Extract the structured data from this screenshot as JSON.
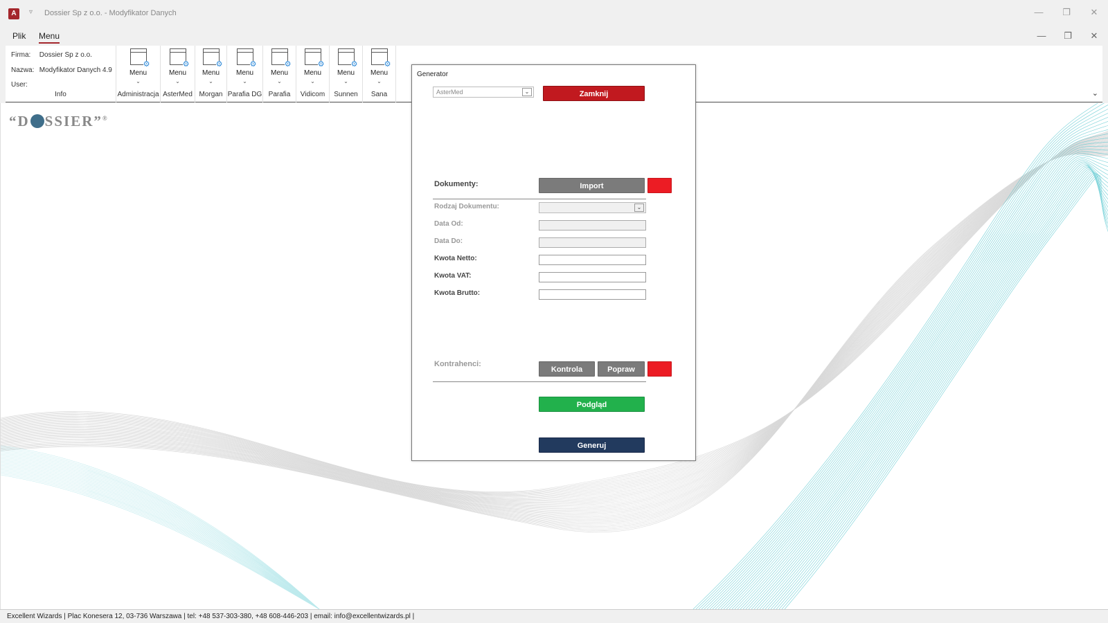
{
  "window": {
    "title": "Dossier Sp z o.o. - Modyfikator Danych",
    "app_icon": "A"
  },
  "ribbon": {
    "tabs": [
      {
        "label": "Plik",
        "active": false
      },
      {
        "label": "Menu",
        "active": true
      }
    ],
    "info": {
      "firma_label": "Firma:",
      "firma_value": "Dossier Sp z o.o.",
      "nazwa_label": "Nazwa:",
      "nazwa_value": "Modyfikator Danych 4.9",
      "user_label": "User:",
      "user_value": "",
      "caption": "Info"
    },
    "groups": [
      {
        "button": "Menu",
        "caption": "Administracja"
      },
      {
        "button": "Menu",
        "caption": "AsterMed"
      },
      {
        "button": "Menu",
        "caption": "Morgan"
      },
      {
        "button": "Menu",
        "caption": "Parafia DG"
      },
      {
        "button": "Menu",
        "caption": "Parafia"
      },
      {
        "button": "Menu",
        "caption": "Vidicom"
      },
      {
        "button": "Menu",
        "caption": "Sunnen"
      },
      {
        "button": "Menu",
        "caption": "Sana"
      }
    ]
  },
  "logo": {
    "left": "“D",
    "right": "SSIER”",
    "mark": "®"
  },
  "dialog": {
    "title": "Generator",
    "company_select": "AsterMed",
    "close_button": "Zamknij",
    "dokumenty_label": "Dokumenty:",
    "import_button": "Import",
    "fields": [
      {
        "label": "Rodzaj Dokumentu:",
        "type": "select",
        "disabled": true
      },
      {
        "label": "Data Od:",
        "type": "text",
        "disabled": true
      },
      {
        "label": "Data Do:",
        "type": "text",
        "disabled": true
      },
      {
        "label": "Kwota Netto:",
        "type": "text",
        "disabled": false
      },
      {
        "label": "Kwota VAT:",
        "type": "text",
        "disabled": false
      },
      {
        "label": "Kwota Brutto:",
        "type": "text",
        "disabled": false
      }
    ],
    "kontrahenci_label": "Kontrahenci:",
    "kontrola_button": "Kontrola",
    "popraw_button": "Popraw",
    "preview_button": "Podgląd",
    "generate_button": "Generuj"
  },
  "status_bar": {
    "text": "Excellent Wizards | Plac Konesera 12, 03-736 Warszawa | tel: +48 537-303-380, +48 608-446-203 | email: info@excellentwizards.pl |"
  },
  "colors": {
    "accent": "#a4262c",
    "close_red": "#c1191f",
    "status_red": "#ec1c24",
    "preview_green": "#22b14c",
    "generate_navy": "#223a5e",
    "wave_teal": "#5cc8d0"
  }
}
